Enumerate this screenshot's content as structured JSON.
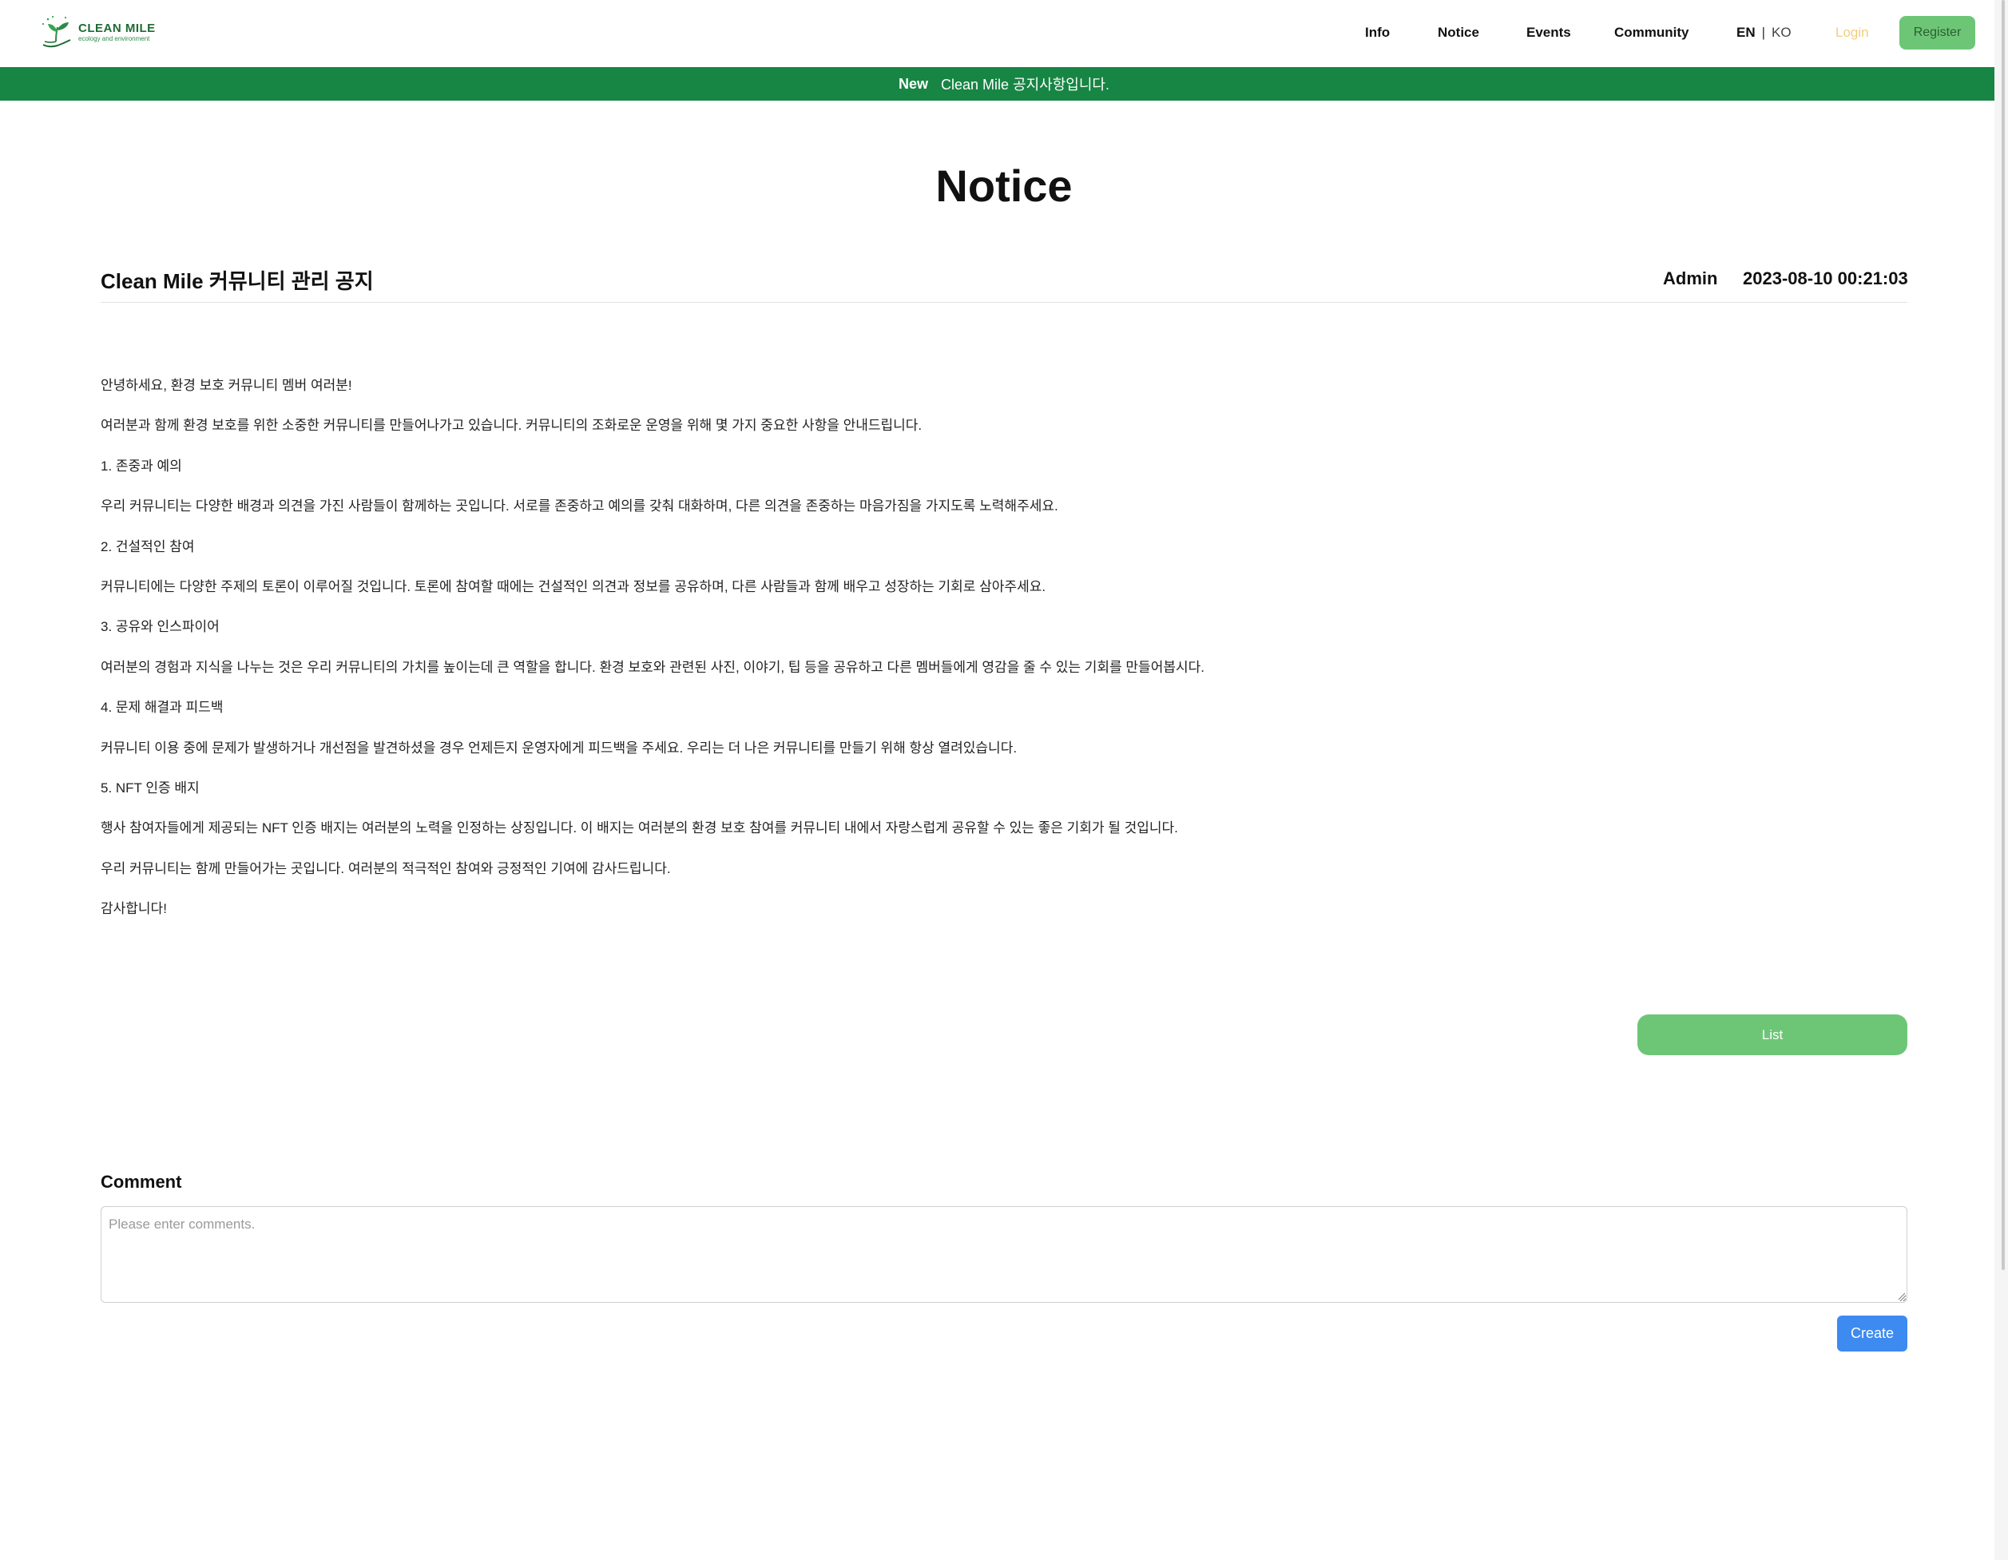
{
  "logo": {
    "title": "CLEAN MILE",
    "subtitle": "ecology and environment",
    "icon": "sprout-hand-icon"
  },
  "nav": {
    "items": [
      {
        "label": "Info"
      },
      {
        "label": "Notice"
      },
      {
        "label": "Events"
      },
      {
        "label": "Community"
      }
    ],
    "lang_en": "EN",
    "lang_sep": "|",
    "lang_ko": "KO",
    "login": "Login",
    "register": "Register"
  },
  "banner": {
    "badge": "New",
    "text": "Clean Mile 공지사항입니다."
  },
  "page_title": "Notice",
  "post": {
    "title": "Clean Mile 커뮤니티 관리 공지",
    "author": "Admin",
    "date": "2023-08-10 00:21:03",
    "paragraphs": [
      "안녕하세요, 환경 보호 커뮤니티 멤버 여러분!",
      "여러분과 함께 환경 보호를 위한 소중한 커뮤니티를 만들어나가고 있습니다. 커뮤니티의 조화로운 운영을 위해 몇 가지 중요한 사항을 안내드립니다.",
      "1. 존중과 예의",
      "우리 커뮤니티는 다양한 배경과 의견을 가진 사람들이 함께하는 곳입니다. 서로를 존중하고 예의를 갖춰 대화하며, 다른 의견을 존중하는 마음가짐을 가지도록 노력해주세요.",
      "2. 건설적인 참여",
      "커뮤니티에는 다양한 주제의 토론이 이루어질 것입니다. 토론에 참여할 때에는 건설적인 의견과 정보를 공유하며, 다른 사람들과 함께 배우고 성장하는 기회로 삼아주세요.",
      "3. 공유와 인스파이어",
      "여러분의 경험과 지식을 나누는 것은 우리 커뮤니티의 가치를 높이는데 큰 역할을 합니다. 환경 보호와 관련된 사진, 이야기, 팁 등을 공유하고 다른 멤버들에게 영감을 줄 수 있는 기회를 만들어봅시다.",
      "4. 문제 해결과 피드백",
      "커뮤니티 이용 중에 문제가 발생하거나 개선점을 발견하셨을 경우 언제든지 운영자에게 피드백을 주세요. 우리는 더 나은 커뮤니티를 만들기 위해 항상 열려있습니다.",
      "5. NFT 인증 배지",
      "행사 참여자들에게 제공되는 NFT 인증 배지는 여러분의 노력을 인정하는 상징입니다. 이 배지는 여러분의 환경 보호 참여를 커뮤니티 내에서 자랑스럽게 공유할 수 있는 좋은 기회가 될 것입니다.",
      "우리 커뮤니티는 함께 만들어가는 곳입니다. 여러분의 적극적인 참여와 긍정적인 기여에 감사드립니다.",
      "감사합니다!"
    ]
  },
  "list_button": "List",
  "comment": {
    "label": "Comment",
    "placeholder": "Please enter comments.",
    "value": "",
    "create_button": "Create"
  },
  "colors": {
    "brand_green": "#178543",
    "button_green": "#6cc676",
    "login_yellow": "#f2cd7e",
    "create_blue": "#3d8af1"
  }
}
